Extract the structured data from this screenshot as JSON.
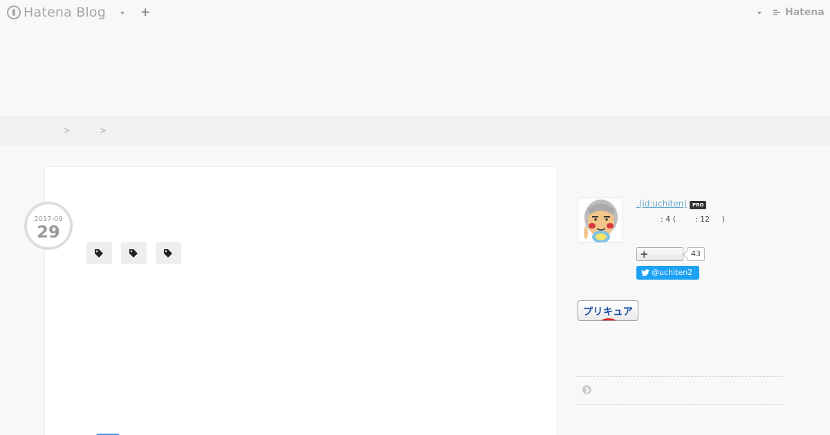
{
  "header": {
    "brand_name": "Hatena Blog",
    "add_label": "+",
    "hatena_label": "Hatena"
  },
  "breadcrumb": {
    "separators": [
      ">",
      ">"
    ]
  },
  "entry": {
    "date_year_month": "2017-09",
    "date_day": "29",
    "tags": [
      "",
      "",
      ""
    ]
  },
  "sidebar": {
    "author_name": ".(id:uchiten)",
    "pro_badge": "PRO",
    "stats_text": ": 4 (        : 12     )",
    "follow_count": "43",
    "twitter_handle": "@uchiten2",
    "banner_text": "プリキュア",
    "colors": {
      "twitter": "#1da1f2",
      "link": "#68a8c8",
      "banner_text": "#1d4fa6",
      "banner_accent": "#e02020"
    }
  }
}
